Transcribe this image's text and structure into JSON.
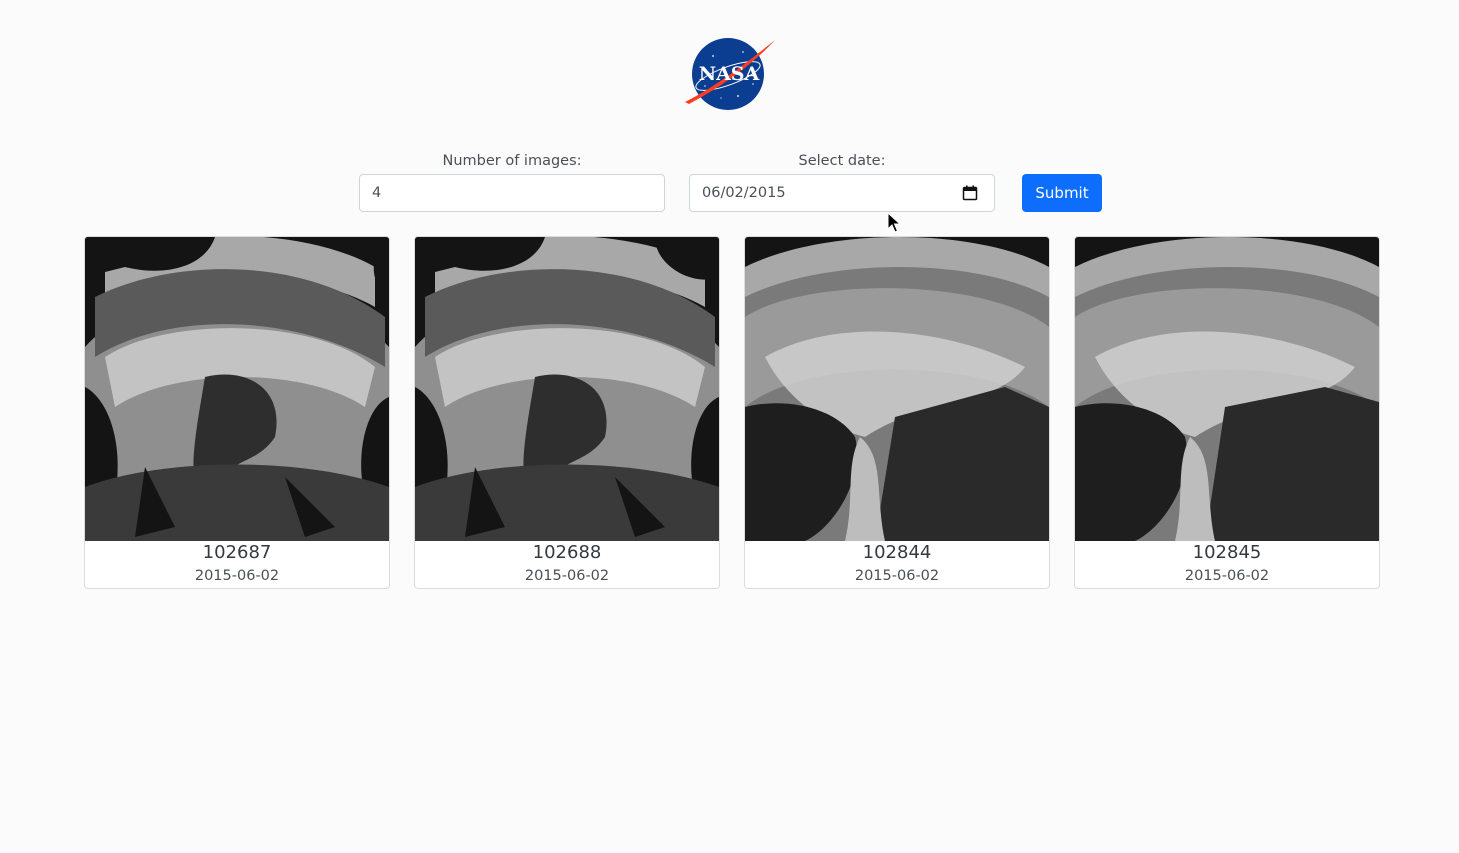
{
  "logo": {
    "icon": "nasa-logo",
    "text": "NASA",
    "colors": {
      "blue": "#0b3d91",
      "red": "#fc3d21"
    }
  },
  "form": {
    "count_label": "Number of images:",
    "count_value": "4",
    "date_label": "Select date:",
    "date_value": "06/02/2015",
    "date_icon": "calendar-icon",
    "submit_label": "Submit",
    "accent": "#0d6efd"
  },
  "photos": [
    {
      "id": "102687",
      "date": "2015-06-02"
    },
    {
      "id": "102688",
      "date": "2015-06-02"
    },
    {
      "id": "102844",
      "date": "2015-06-02"
    },
    {
      "id": "102845",
      "date": "2015-06-02"
    }
  ]
}
